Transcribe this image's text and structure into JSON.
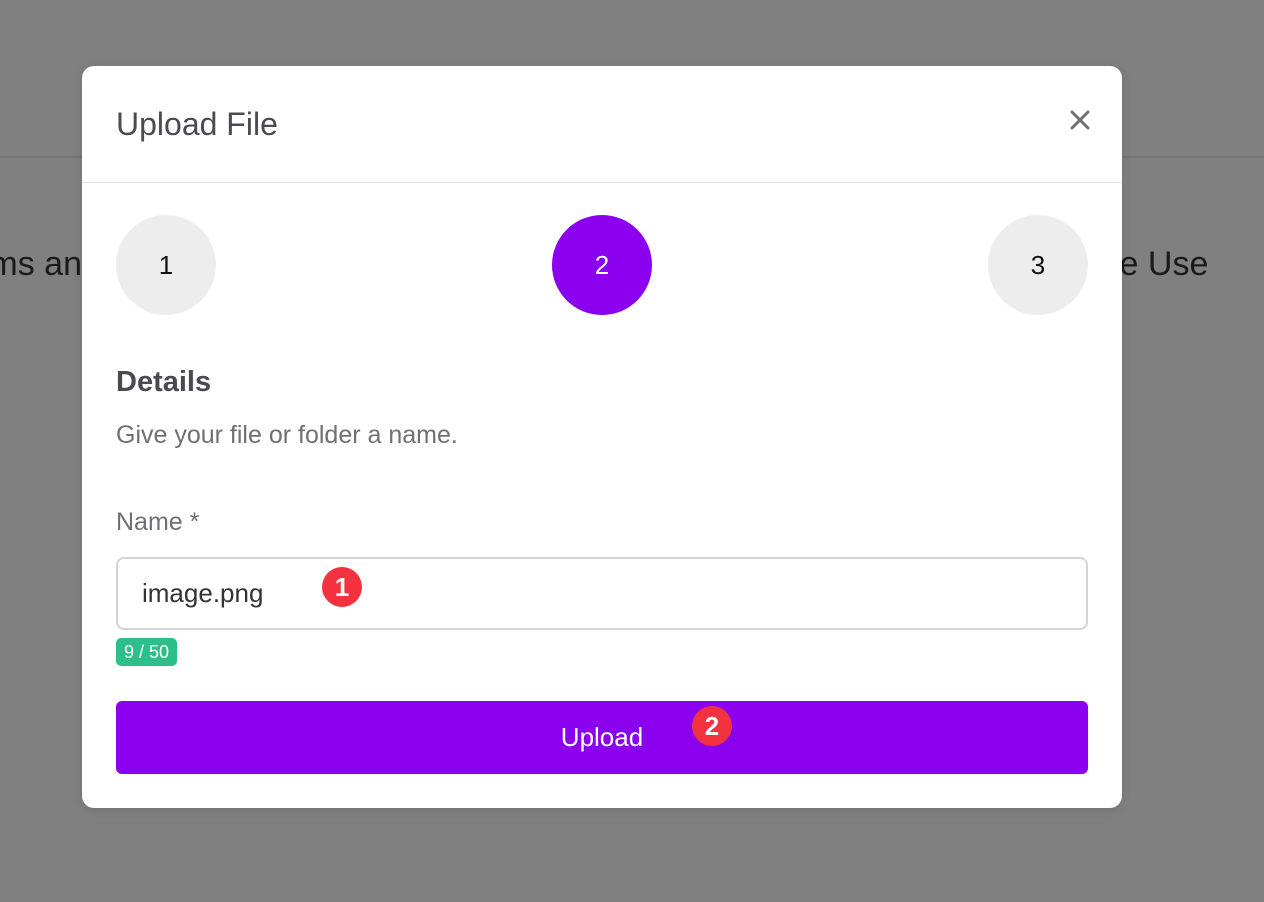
{
  "background": {
    "text_left": "ms an",
    "text_right": "le Use"
  },
  "modal": {
    "title": "Upload File",
    "close_icon": "close-icon",
    "steps": [
      {
        "label": "1",
        "active": false
      },
      {
        "label": "2",
        "active": true
      },
      {
        "label": "3",
        "active": false
      }
    ],
    "section_title": "Details",
    "section_description": "Give your file or folder a name.",
    "name_field": {
      "label": "Name *",
      "value": "image.png",
      "char_count": "9 / 50"
    },
    "upload_button_label": "Upload"
  },
  "annotations": {
    "marker_1": "1",
    "marker_2": "2"
  },
  "colors": {
    "accent": "#8b00ee",
    "counter_badge": "#2dbf8a",
    "annotation_marker": "#f2333f"
  }
}
